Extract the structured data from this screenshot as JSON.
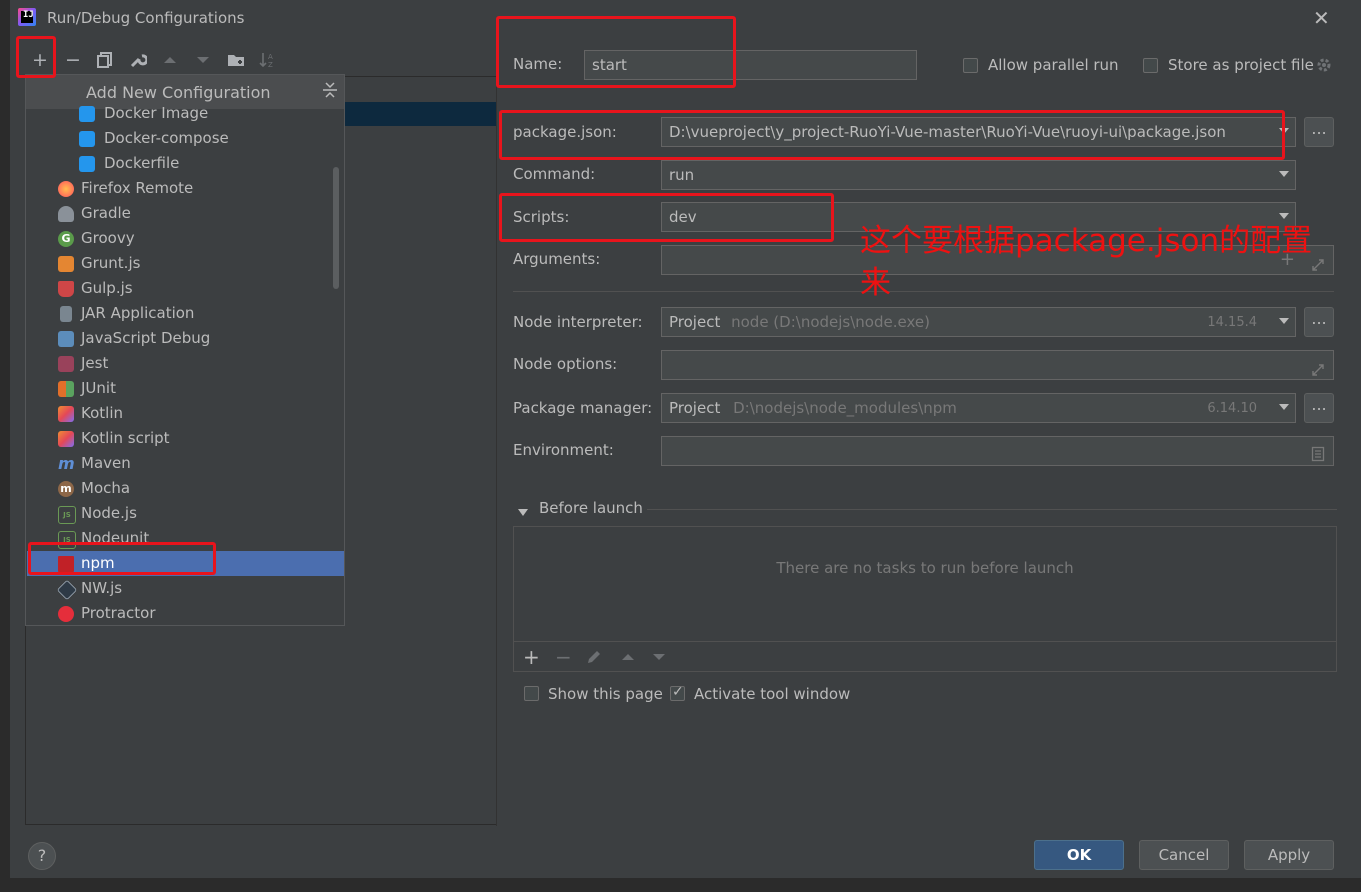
{
  "window": {
    "title": "Run/Debug Configurations",
    "close_label": "✕"
  },
  "toolbar": {
    "add": "+",
    "remove": "−"
  },
  "popup": {
    "title": "Add New Configuration",
    "items": [
      {
        "label": "Docker Image",
        "icon": "docker-icon",
        "indent": true
      },
      {
        "label": "Docker-compose",
        "icon": "docker-icon",
        "indent": true
      },
      {
        "label": "Dockerfile",
        "icon": "docker-icon",
        "indent": true
      },
      {
        "label": "Firefox Remote",
        "icon": "firefox-icon"
      },
      {
        "label": "Gradle",
        "icon": "gradle-icon"
      },
      {
        "label": "Groovy",
        "icon": "groovy-icon",
        "glyph": "G"
      },
      {
        "label": "Grunt.js",
        "icon": "grunt-icon"
      },
      {
        "label": "Gulp.js",
        "icon": "gulp-icon"
      },
      {
        "label": "JAR Application",
        "icon": "jar-icon"
      },
      {
        "label": "JavaScript Debug",
        "icon": "js-debug-icon"
      },
      {
        "label": "Jest",
        "icon": "jest-icon"
      },
      {
        "label": "JUnit",
        "icon": "junit-icon"
      },
      {
        "label": "Kotlin",
        "icon": "kotlin-icon"
      },
      {
        "label": "Kotlin script",
        "icon": "kotlin-icon"
      },
      {
        "label": "Maven",
        "icon": "maven-icon",
        "glyph": "m"
      },
      {
        "label": "Mocha",
        "icon": "mocha-icon",
        "glyph": "m"
      },
      {
        "label": "Node.js",
        "icon": "nodejs-icon",
        "glyph": "JS"
      },
      {
        "label": "Nodeunit",
        "icon": "nodeunit-icon",
        "glyph": "JS"
      },
      {
        "label": "npm",
        "icon": "npm-icon",
        "selected": true
      },
      {
        "label": "NW.js",
        "icon": "nwjs-icon"
      },
      {
        "label": "Protractor",
        "icon": "protractor-icon"
      }
    ]
  },
  "form": {
    "name_label": "Name:",
    "name_value": "start",
    "allow_parallel": "Allow parallel run",
    "store_project": "Store as project file",
    "package_json_label": "package.json:",
    "package_json_value": "D:\\vueproject\\y_project-RuoYi-Vue-master\\RuoYi-Vue\\ruoyi-ui\\package.json",
    "command_label": "Command:",
    "command_value": "run",
    "scripts_label": "Scripts:",
    "scripts_value": "dev",
    "arguments_label": "Arguments:",
    "node_interpreter_label": "Node interpreter:",
    "node_interpreter_kind": "Project",
    "node_interpreter_path": "node (D:\\nodejs\\node.exe)",
    "node_interpreter_version": "14.15.4",
    "node_options_label": "Node options:",
    "package_manager_label": "Package manager:",
    "package_manager_kind": "Project",
    "package_manager_path": "D:\\nodejs\\node_modules\\npm",
    "package_manager_version": "6.14.10",
    "environment_label": "Environment:",
    "dots": "..."
  },
  "before_launch": {
    "title": "Before launch",
    "empty_text": "There are no tasks to run before launch",
    "show_page": "Show this page",
    "activate_tool": "Activate tool window"
  },
  "buttons": {
    "ok": "OK",
    "cancel": "Cancel",
    "apply": "Apply",
    "help": "?"
  },
  "annotation": {
    "text": "这个要根据package.json的配置来"
  },
  "colors": {
    "selection": "#4b6eaf",
    "highlight_box": "#e8141c",
    "annotation": "#ee1111",
    "primary_button": "#365880"
  }
}
